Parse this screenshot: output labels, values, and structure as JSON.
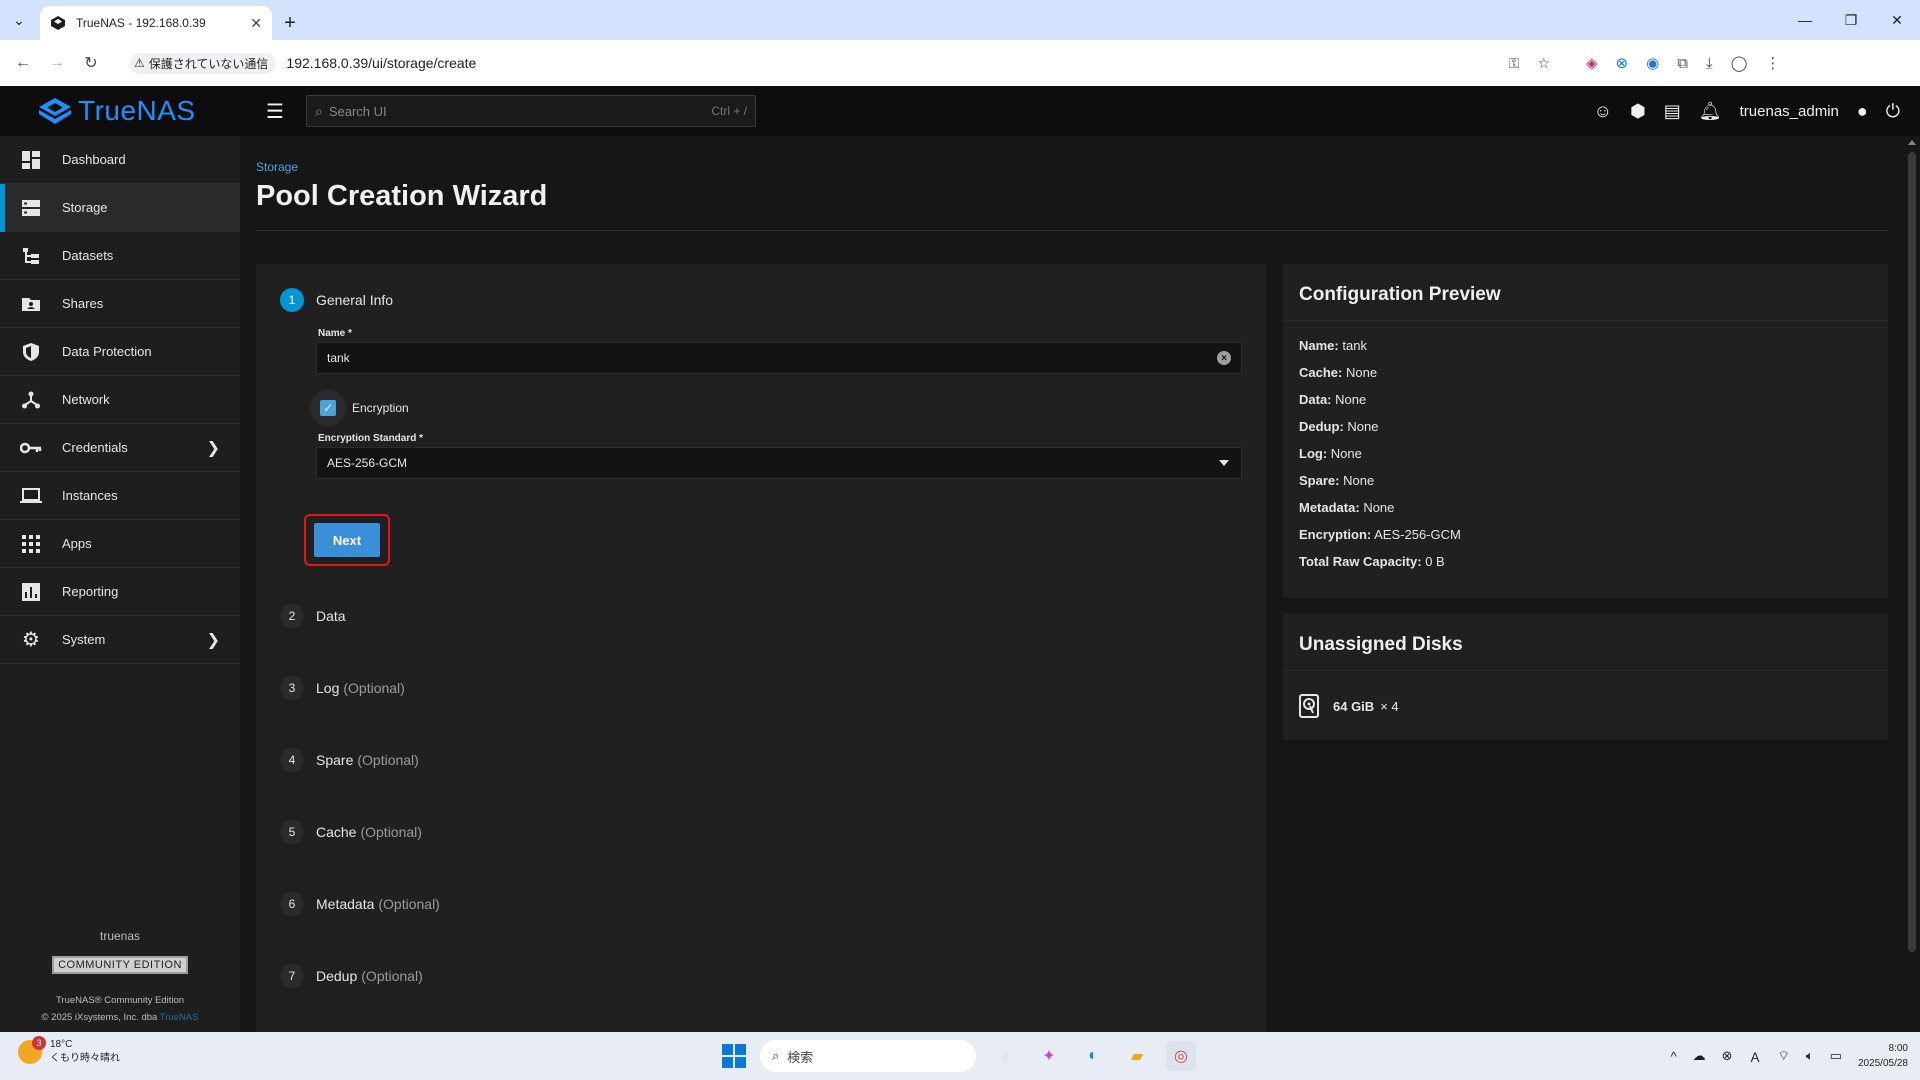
{
  "browser": {
    "tab_title": "TrueNAS - 192.168.0.39",
    "security_label": "保護されていない通信",
    "url": "192.168.0.39/ui/storage/create"
  },
  "header": {
    "brand": "TrueNAS",
    "search_placeholder": "Search UI",
    "search_shortcut": "Ctrl + /",
    "username": "truenas_admin"
  },
  "sidebar": {
    "items": [
      {
        "label": "Dashboard",
        "icon": "dashboard-icon"
      },
      {
        "label": "Storage",
        "icon": "storage-icon",
        "active": true
      },
      {
        "label": "Datasets",
        "icon": "datasets-icon"
      },
      {
        "label": "Shares",
        "icon": "shares-icon"
      },
      {
        "label": "Data Protection",
        "icon": "shield-icon"
      },
      {
        "label": "Network",
        "icon": "network-icon"
      },
      {
        "label": "Credentials",
        "icon": "key-icon",
        "expandable": true
      },
      {
        "label": "Instances",
        "icon": "laptop-icon"
      },
      {
        "label": "Apps",
        "icon": "apps-icon"
      },
      {
        "label": "Reporting",
        "icon": "reporting-icon"
      },
      {
        "label": "System",
        "icon": "gear-icon",
        "expandable": true
      }
    ],
    "hostname": "truenas",
    "edition": "COMMUNITY EDITION",
    "copyright_line1": "TrueNAS® Community Edition",
    "copyright_line2": "© 2025 iXsystems, Inc. dba",
    "copyright_brand": "TrueNAS"
  },
  "page": {
    "breadcrumb": "Storage",
    "title": "Pool Creation Wizard"
  },
  "wizard": {
    "steps": [
      {
        "num": "1",
        "label": "General Info",
        "optional": ""
      },
      {
        "num": "2",
        "label": "Data",
        "optional": ""
      },
      {
        "num": "3",
        "label": "Log",
        "optional": "(Optional)"
      },
      {
        "num": "4",
        "label": "Spare",
        "optional": "(Optional)"
      },
      {
        "num": "5",
        "label": "Cache",
        "optional": "(Optional)"
      },
      {
        "num": "6",
        "label": "Metadata",
        "optional": "(Optional)"
      },
      {
        "num": "7",
        "label": "Dedup",
        "optional": "(Optional)"
      }
    ],
    "name_label": "Name *",
    "name_value": "tank",
    "encryption_label": "Encryption",
    "encryption_checked": true,
    "encryption_standard_label": "Encryption Standard *",
    "encryption_standard_value": "AES-256-GCM",
    "next_label": "Next"
  },
  "preview": {
    "title": "Configuration Preview",
    "rows": [
      {
        "key": "Name:",
        "value": "tank"
      },
      {
        "key": "Cache:",
        "value": "None"
      },
      {
        "key": "Data:",
        "value": "None"
      },
      {
        "key": "Dedup:",
        "value": "None"
      },
      {
        "key": "Log:",
        "value": "None"
      },
      {
        "key": "Spare:",
        "value": "None"
      },
      {
        "key": "Metadata:",
        "value": "None"
      },
      {
        "key": "Encryption:",
        "value": "AES-256-GCM"
      },
      {
        "key": "Total Raw Capacity:",
        "value": "0 B"
      }
    ]
  },
  "unassigned": {
    "title": "Unassigned Disks",
    "disk_size": "64 GiB",
    "disk_count": "× 4"
  },
  "taskbar": {
    "temperature": "18°C",
    "weather": "くもり時々晴れ",
    "notification_count": "3",
    "search_placeholder": "検索",
    "time": "8:00",
    "date": "2025/05/28"
  },
  "colors": {
    "accent": "#0095d5",
    "button": "#3b8fd9",
    "highlight": "#e4141b"
  }
}
